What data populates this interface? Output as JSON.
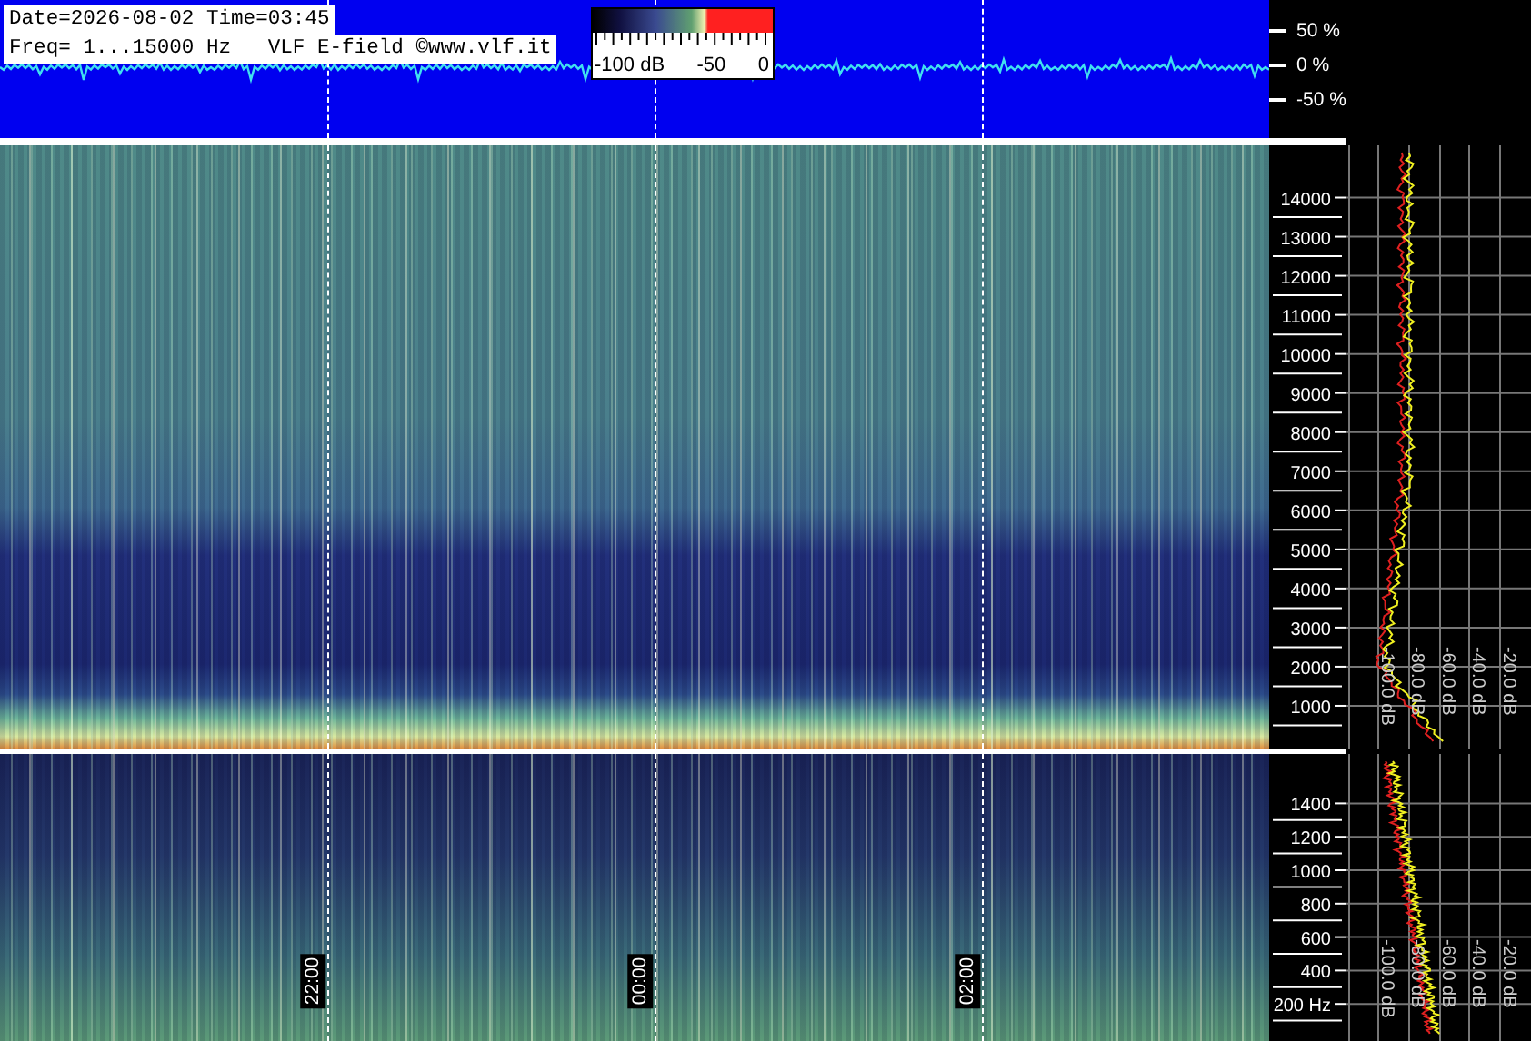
{
  "header": {
    "date_time": "Date=2026-08-02 Time=03:45",
    "info": "Freq= 1...15000 Hz   VLF E-field ©www.vlf.it"
  },
  "color_scale": {
    "labels": [
      "-100 dB",
      "-50",
      "0"
    ]
  },
  "amplitude_axis": {
    "labels": [
      "50 %",
      "0 %",
      "-50 %"
    ]
  },
  "upper_panel": {
    "freq_labels": [
      "14000",
      "13000",
      "12000",
      "11000",
      "10000",
      "9000",
      "8000",
      "7000",
      "6000",
      "5000",
      "4000",
      "3000",
      "2000",
      "1000"
    ],
    "db_labels": [
      "-100.0 dB",
      "-80.0 dB",
      "-60.0 dB",
      "-40.0 dB",
      "-20.0 dB"
    ]
  },
  "lower_panel": {
    "freq_labels": [
      "1400",
      "1200",
      "1000",
      "800",
      "600",
      "400",
      "200 Hz"
    ],
    "db_labels": [
      "-100.0 dB",
      "-80.0 dB",
      "-60.0 dB",
      "-40.0 dB",
      "-20.0 dB"
    ]
  },
  "time_labels": [
    "22:00",
    "00:00",
    "02:00"
  ]
}
